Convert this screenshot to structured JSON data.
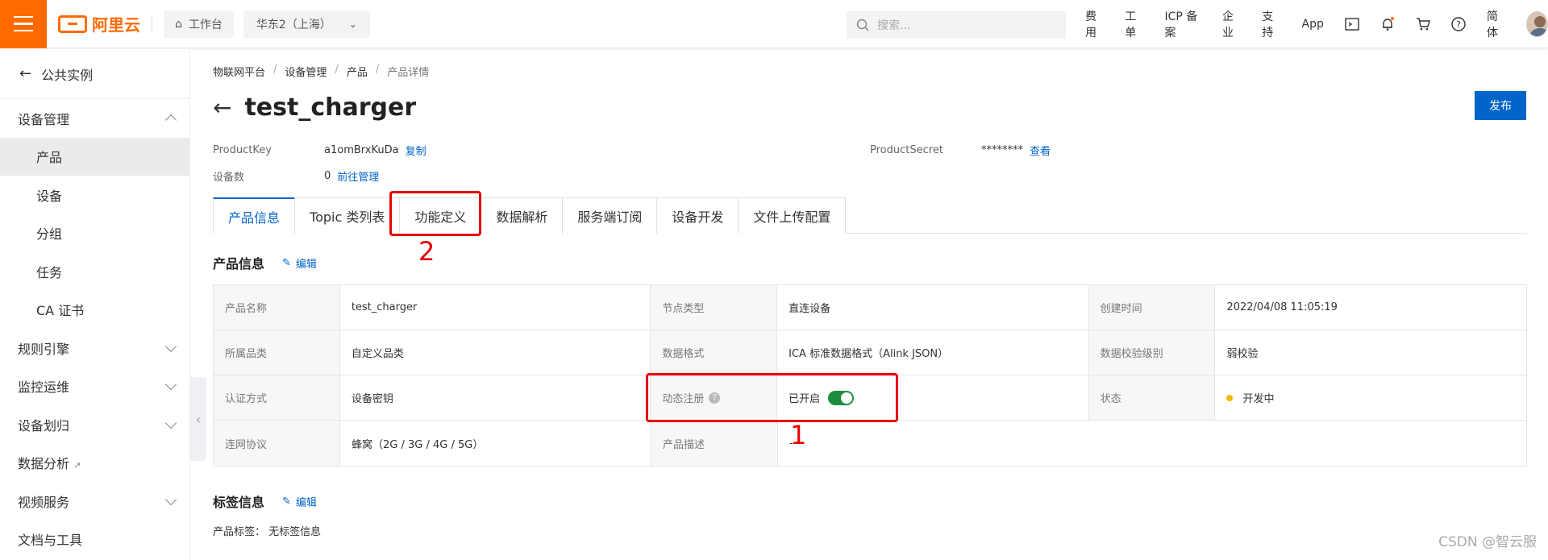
{
  "topbar": {
    "brand": "阿里云",
    "workbench": "工作台",
    "region": "华东2（上海）",
    "search_placeholder": "搜索...",
    "links": [
      "费用",
      "工单",
      "ICP 备案",
      "企业",
      "支持",
      "App"
    ],
    "language": "简体"
  },
  "sidebar": {
    "back_label": "公共实例",
    "items": [
      {
        "label": "设备管理",
        "type": "group",
        "expanded": true
      },
      {
        "label": "产品",
        "type": "sub",
        "active": true
      },
      {
        "label": "设备",
        "type": "sub"
      },
      {
        "label": "分组",
        "type": "sub"
      },
      {
        "label": "任务",
        "type": "sub"
      },
      {
        "label": "CA 证书",
        "type": "sub"
      },
      {
        "label": "规则引擎",
        "type": "group"
      },
      {
        "label": "监控运维",
        "type": "group"
      },
      {
        "label": "设备划归",
        "type": "group"
      },
      {
        "label": "数据分析",
        "type": "group"
      },
      {
        "label": "视频服务",
        "type": "group"
      },
      {
        "label": "文档与工具",
        "type": "group"
      }
    ]
  },
  "breadcrumb": [
    "物联网平台",
    "设备管理",
    "产品",
    "产品详情"
  ],
  "page": {
    "title": "test_charger",
    "publish": "发布",
    "product_key_label": "ProductKey",
    "product_key": "a1omBrxKuDa",
    "copy": "复制",
    "product_secret_label": "ProductSecret",
    "product_secret": "********",
    "view": "查看",
    "device_count_label": "设备数",
    "device_count": "0",
    "manage_link": "前往管理"
  },
  "tabs": [
    "产品信息",
    "Topic 类列表",
    "功能定义",
    "数据解析",
    "服务端订阅",
    "设备开发",
    "文件上传配置"
  ],
  "product_info": {
    "heading": "产品信息",
    "edit": "编辑",
    "rows": [
      [
        [
          "产品名称",
          "test_charger"
        ],
        [
          "节点类型",
          "直连设备"
        ],
        [
          "创建时间",
          "2022/04/08 11:05:19"
        ]
      ],
      [
        [
          "所属品类",
          "自定义品类"
        ],
        [
          "数据格式",
          "ICA 标准数据格式（Alink JSON）"
        ],
        [
          "数据校验级别",
          "弱校验"
        ]
      ],
      [
        [
          "认证方式",
          "设备密钥"
        ],
        [
          "动态注册",
          "已开启"
        ],
        [
          "状态",
          "开发中"
        ]
      ],
      [
        [
          "连网协议",
          "蜂窝（2G / 3G / 4G / 5G）"
        ],
        [
          "产品描述",
          "-"
        ]
      ]
    ]
  },
  "tag_info": {
    "heading": "标签信息",
    "edit": "编辑",
    "line_label": "产品标签：",
    "line_value": "无标签信息"
  },
  "annotations": {
    "one": "1",
    "two": "2"
  },
  "watermark": "CSDN @智云服",
  "colors": {
    "accent": "#ff6a00",
    "link": "#0064c8",
    "annotation": "#e60000",
    "toggle_on": "#1e8e3e",
    "status_dev": "#f6b700"
  }
}
